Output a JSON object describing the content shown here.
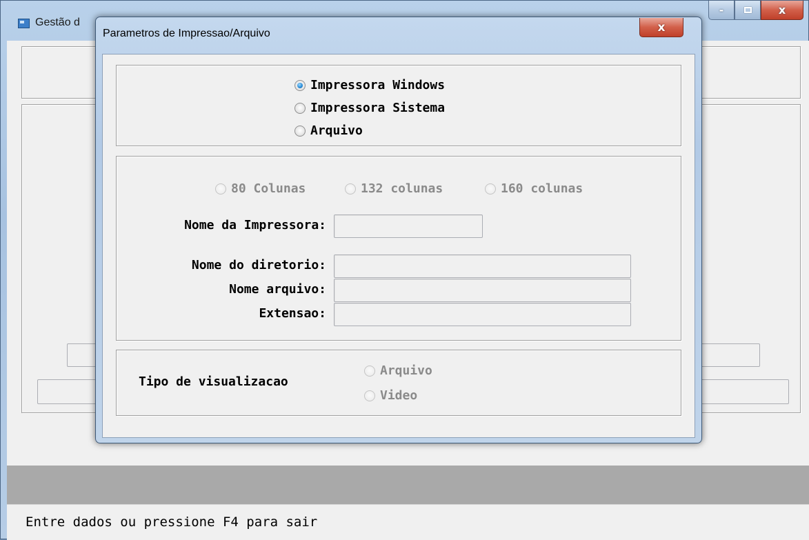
{
  "main_window": {
    "title": "Gestão d",
    "caption": {
      "minimize_glyph": "-",
      "close_glyph": "x"
    },
    "status_text": "Entre dados ou pressione F4 para sair"
  },
  "dialog": {
    "title": "Parametros de Impressao/Arquivo",
    "close_glyph": "x",
    "destination": {
      "options": [
        {
          "label": "Impressora Windows",
          "checked": true
        },
        {
          "label": "Impressora Sistema",
          "checked": false
        },
        {
          "label": "Arquivo",
          "checked": false
        }
      ]
    },
    "columns": {
      "options": [
        {
          "label": "80 Colunas",
          "enabled": false
        },
        {
          "label": "132 colunas",
          "enabled": false
        },
        {
          "label": "160 colunas",
          "enabled": false
        }
      ]
    },
    "printer_name": {
      "label": "Nome da Impressora:",
      "value": ""
    },
    "directory": {
      "label": "Nome do diretorio:",
      "value": ""
    },
    "file_name": {
      "label": "Nome arquivo:",
      "value": ""
    },
    "extension": {
      "label": "Extensao:",
      "value": ""
    },
    "view_type": {
      "label": "Tipo de visualizacao",
      "options": [
        {
          "label": "Arquivo",
          "enabled": false
        },
        {
          "label": "Video",
          "enabled": false
        }
      ]
    }
  },
  "colors": {
    "title_gradient": "#b9d1ea",
    "window_bg": "#f0f0f0",
    "band": "#a9a9a9",
    "close_button": "#c0402a",
    "radio_selected": "#2d8fd8",
    "disabled_text": "#8a8a8a"
  }
}
